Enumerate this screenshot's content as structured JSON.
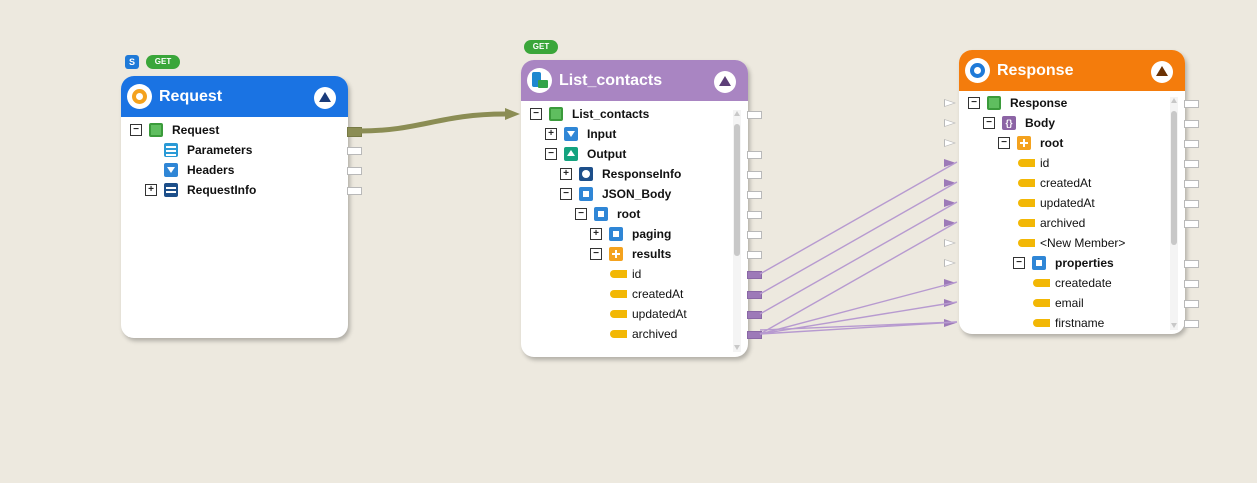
{
  "request_card": {
    "badge_s": "S",
    "badge_get": "GET",
    "title": "Request",
    "header_color": "#1a73e3",
    "rows": [
      {
        "label": "Request"
      },
      {
        "label": "Parameters"
      },
      {
        "label": "Headers"
      },
      {
        "label": "RequestInfo"
      }
    ]
  },
  "list_contacts_card": {
    "badge_get": "GET",
    "title": "List_contacts",
    "header_color": "#a985c2",
    "rows": [
      {
        "label": "List_contacts"
      },
      {
        "label": "Input"
      },
      {
        "label": "Output"
      },
      {
        "label": "ResponseInfo"
      },
      {
        "label": "JSON_Body"
      },
      {
        "label": "root"
      },
      {
        "label": "paging"
      },
      {
        "label": "results"
      },
      {
        "label": "id"
      },
      {
        "label": "createdAt"
      },
      {
        "label": "updatedAt"
      },
      {
        "label": "archived"
      }
    ]
  },
  "response_card": {
    "title": "Response",
    "header_color": "#f47c0c",
    "rows": [
      {
        "label": "Response"
      },
      {
        "label": "Body"
      },
      {
        "label": "root"
      },
      {
        "label": "id"
      },
      {
        "label": "createdAt"
      },
      {
        "label": "updatedAt"
      },
      {
        "label": "archived"
      },
      {
        "label": "<New Member>"
      },
      {
        "label": "properties"
      },
      {
        "label": "createdate"
      },
      {
        "label": "email"
      },
      {
        "label": "firstname"
      }
    ]
  },
  "toggles": {
    "plus": "+",
    "minus": "−"
  },
  "icons": {
    "body_object": "{}"
  },
  "colors": {
    "canvas": "#ede9df",
    "mapping_line": "#b79ad0",
    "flow_line": "#8b8d54"
  }
}
